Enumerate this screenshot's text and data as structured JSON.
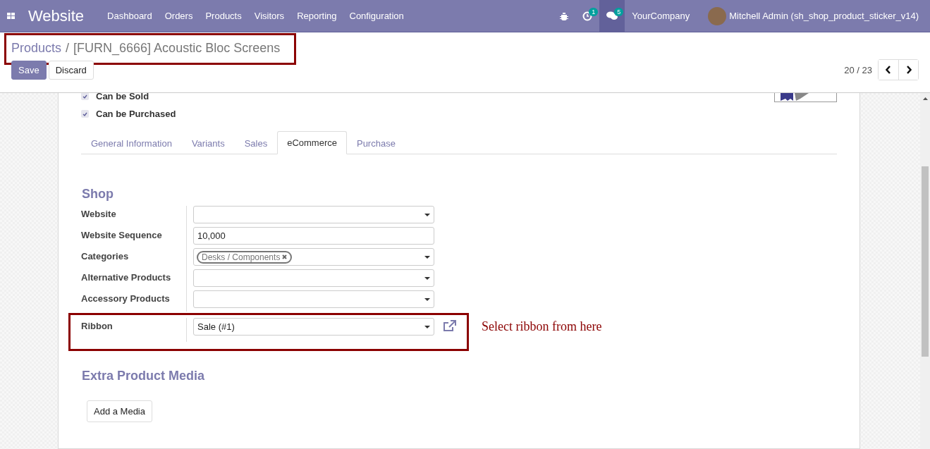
{
  "navbar": {
    "app_title": "Website",
    "menu": [
      "Dashboard",
      "Orders",
      "Products",
      "Visitors",
      "Reporting",
      "Configuration"
    ],
    "activity_count": "1",
    "message_count": "5",
    "company": "YourCompany",
    "user": "Mitchell Admin (sh_shop_product_sticker_v14)"
  },
  "breadcrumb": {
    "parent": "Products",
    "separator": "/",
    "current": "[FURN_6666] Acoustic Bloc Screens"
  },
  "buttons": [
    "Save",
    "Discard"
  ],
  "pager": {
    "text": "20 / 23"
  },
  "checkboxes": [
    {
      "label": "Can be Sold",
      "checked": true
    },
    {
      "label": "Can be Purchased",
      "checked": true
    }
  ],
  "tabs": [
    {
      "label": "General Information",
      "selected": false
    },
    {
      "label": "Variants",
      "selected": false
    },
    {
      "label": "Sales",
      "selected": false
    },
    {
      "label": "eCommerce",
      "selected": true
    },
    {
      "label": "Purchase",
      "selected": false
    }
  ],
  "shop": {
    "title": "Shop",
    "fields": [
      {
        "label": "Website",
        "kind": "select"
      },
      {
        "label": "Website Sequence",
        "kind": "input",
        "value": "10,000"
      },
      {
        "label": "Categories",
        "kind": "tags",
        "tags": [
          "Desks / Components"
        ]
      },
      {
        "label": "Alternative Products",
        "kind": "select"
      },
      {
        "label": "Accessory Products",
        "kind": "select"
      }
    ],
    "ribbon": {
      "label": "Ribbon",
      "value": "Sale (#1)"
    }
  },
  "annotation": "Select ribbon from here",
  "media": {
    "title": "Extra Product Media",
    "button": "Add a Media"
  }
}
